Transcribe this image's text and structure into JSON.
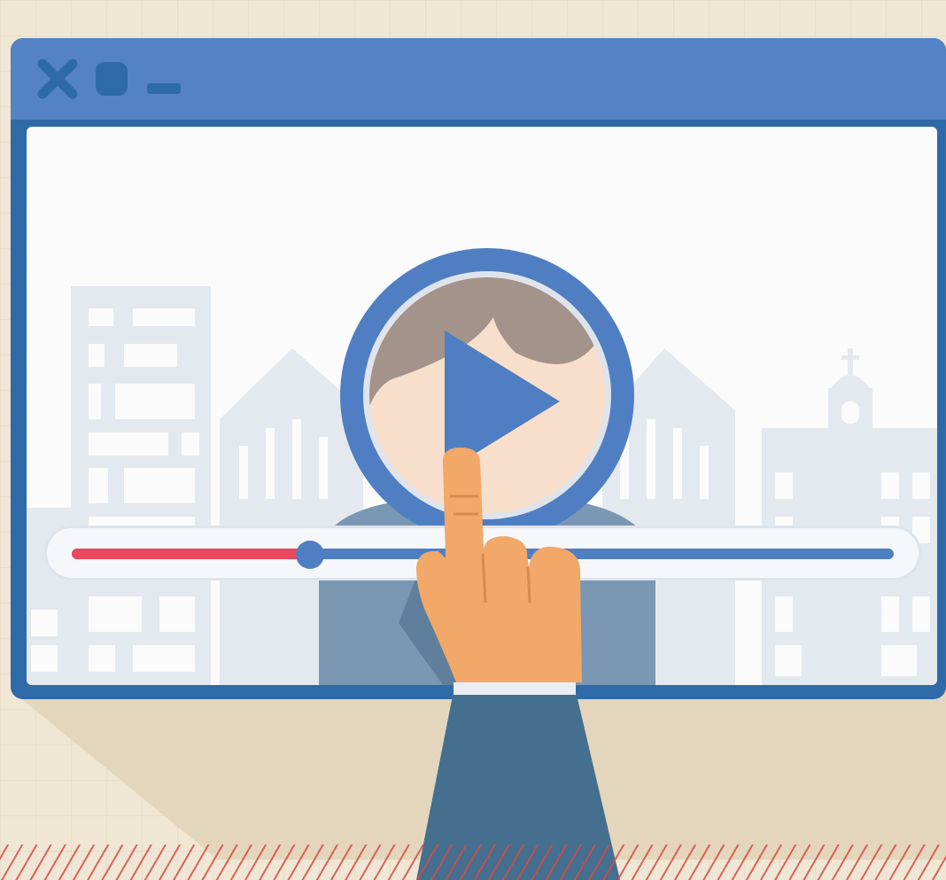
{
  "window": {
    "controls": [
      {
        "icon": "close-icon"
      },
      {
        "icon": "maximize-icon"
      },
      {
        "icon": "minimize-icon"
      }
    ]
  },
  "player": {
    "play_icon": "play-icon",
    "progress_fraction": 0.29
  },
  "colors": {
    "background": "#efe6d3",
    "window_frame": "#2f6aa8",
    "titlebar": "#5383c4",
    "progress_played": "#e9485f",
    "progress_track": "#4f7fc2",
    "skin": "#f2a868",
    "sleeve": "#456f8e"
  }
}
